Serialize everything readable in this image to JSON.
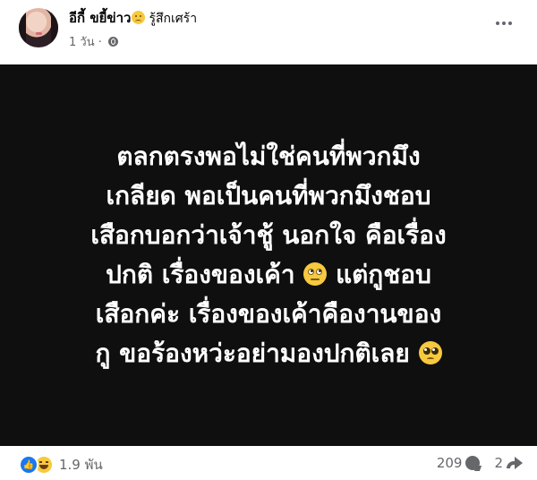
{
  "post": {
    "author": "อีกี้ ขยี้ข่าว",
    "feeling_icon": "sad-face-emoji",
    "feeling_text": "รู้สึกเศร้า",
    "timestamp": "1 วัน",
    "meta_separator": "·",
    "audience_icon": "globe-icon",
    "more_icon": "more-options-icon",
    "content_background": "#0f0f0f",
    "content_text_color": "#ffffff",
    "content_lines": [
      "ตลกตรงพอไม่ใช่คนที่พวกมึง",
      "เกลียด พอเป็นคนที่พวกมึงชอบ",
      "เสือกบอกว่าเจ้าชู้ นอกใจ คือเรื่อง",
      "ปกติ เรื่องของเค้า",
      "แต่กูชอบ",
      "เสือกค่ะ เรื่องของเค้าคืองานของ",
      "กู ขอร้องหว่ะอย่ามองปกติเลย"
    ],
    "content_emojis": [
      "face-with-rolling-eyes-emoji",
      "pleading-face-emoji"
    ]
  },
  "footer": {
    "reaction_icons": [
      "like-reaction-icon",
      "haha-reaction-icon"
    ],
    "reaction_count": "1.9 พัน",
    "comment_count": "209",
    "comment_icon": "comment-icon",
    "share_count": "2",
    "share_icon": "share-icon",
    "like_color": "#1877f2"
  }
}
